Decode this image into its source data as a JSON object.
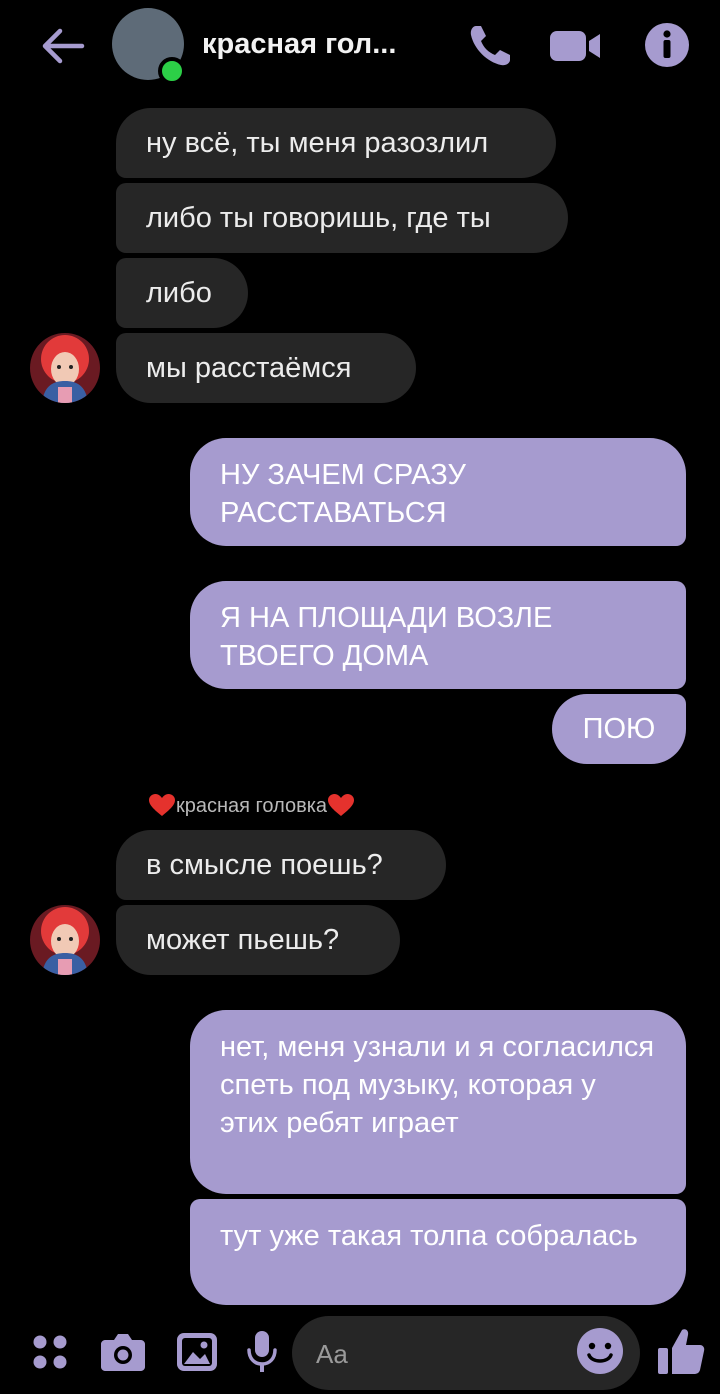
{
  "header": {
    "title": "красная гол..."
  },
  "messages": {
    "m1": "ну всё, ты меня разозлил",
    "m2": "либо ты говоришь, где ты",
    "m3": "либо",
    "m4": "мы расстаёмся",
    "m5": "НУ ЗАЧЕМ СРАЗУ РАССТАВАТЬСЯ",
    "m6": "Я НА ПЛОЩАДИ ВОЗЛЕ ТВОЕГО ДОМА",
    "m7": "ПОЮ",
    "sender": "красная головка",
    "m8": "в смысле поешь?",
    "m9": "может пьешь?",
    "m10": "нет, меня узнали и я согласился спеть под музыку, которая у этих ребят играет",
    "m11": "тут уже такая толпа собралась"
  },
  "composer": {
    "placeholder": "Aa"
  },
  "colors": {
    "accent": "#a69bcf",
    "incoming_bubble": "#262626",
    "online": "#2ccf47",
    "heart": "#e5322d"
  }
}
